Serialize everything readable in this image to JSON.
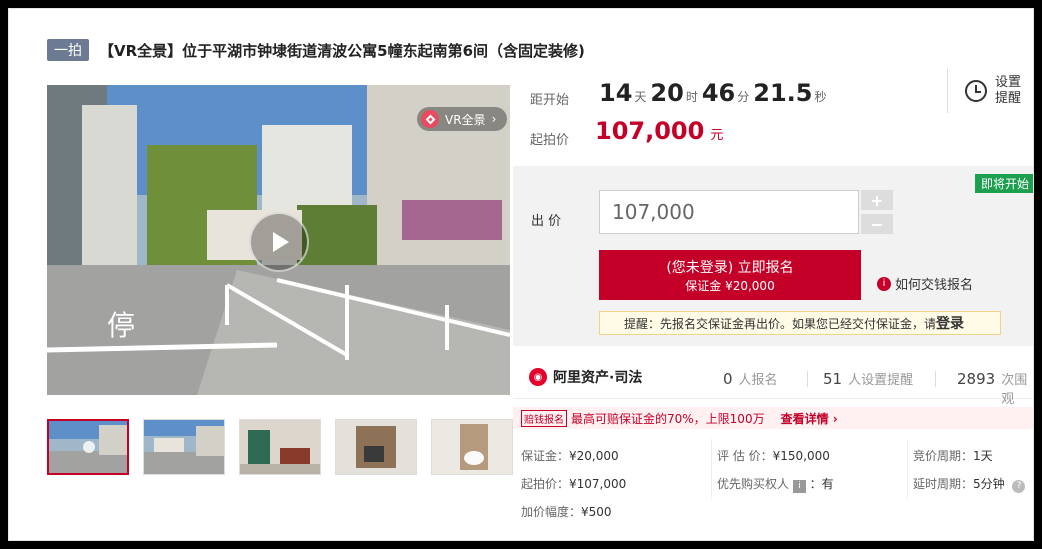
{
  "header": {
    "tag": "一拍",
    "title": "【VR全景】位于平湖市钟埭街道清波公寓5幢东起南第6间（含固定装修)"
  },
  "media": {
    "vr_badge": "VR全景",
    "thumb_count": 5
  },
  "countdown": {
    "label": "距开始",
    "days": "14",
    "days_unit": "天",
    "hours": "20",
    "hours_unit": "时",
    "minutes": "46",
    "minutes_unit": "分",
    "seconds": "21.5",
    "seconds_unit": "秒"
  },
  "start_price": {
    "label": "起拍价",
    "value": "107,000",
    "unit": "元"
  },
  "reminder": {
    "line1": "设置",
    "line2": "提醒"
  },
  "bid": {
    "soon_badge": "即将开始",
    "label": "出 价",
    "value": "107,000",
    "plus": "+",
    "minus": "−",
    "register_line1": "(您未登录) 立即报名",
    "register_line2": "保证金 ¥20,000",
    "howto": "如何交钱报名",
    "tip_text": "提醒：先报名交保证金再出价。如果您已经交付保证金，请",
    "tip_login": "登录"
  },
  "stats": {
    "brand": "阿里资产·司法",
    "registered_count": "0",
    "registered_label": "人报名",
    "reminders_count": "51",
    "reminders_label": "人设置提醒",
    "views_count": "2893",
    "views_label": "次围观"
  },
  "promo": {
    "tag": "赔钱报名",
    "message": "最高可赔保证金的70%，上限100万",
    "link": "查看详情 ›"
  },
  "details": {
    "deposit_k": "保证金：",
    "deposit_v": "¥20,000",
    "start_k": "起拍价：",
    "start_v": "¥107,000",
    "increment_k": "加价幅度：",
    "increment_v": "¥500",
    "appraisal_k": "评 估 价：",
    "appraisal_v": "¥150,000",
    "priority_k": "优先购买权人",
    "priority_badge": "i",
    "priority_v": "：有",
    "cycle_k": "竞价周期：",
    "cycle_v": "1天",
    "delay_k": "延时周期：",
    "delay_v": "5分钟"
  },
  "colors": {
    "accent": "#c40028",
    "green": "#1c9f4f",
    "tag_bg": "#6c7a93"
  }
}
